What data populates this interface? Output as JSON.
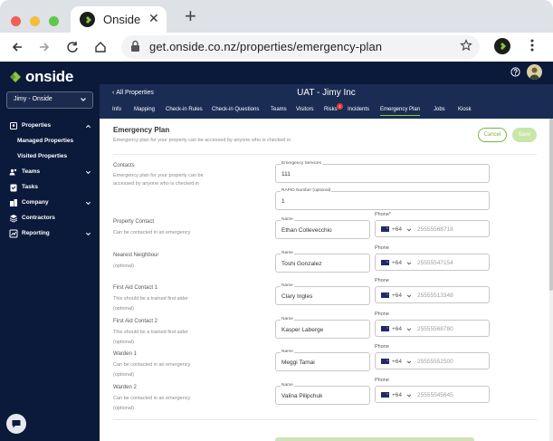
{
  "browser": {
    "tab_title": "Onside",
    "url": "get.onside.co.nz/properties/emergency-plan"
  },
  "sidebar": {
    "logo_text": "onside",
    "org_select": "Jimy - Onside",
    "items": [
      {
        "label": "Properties",
        "icon": "building-icon"
      },
      {
        "label": "Managed Properties"
      },
      {
        "label": "Visited Properties"
      },
      {
        "label": "Teams",
        "icon": "people-icon"
      },
      {
        "label": "Tasks",
        "icon": "clipboard-icon"
      },
      {
        "label": "Company",
        "icon": "company-icon"
      },
      {
        "label": "Contractors",
        "icon": "layers-icon"
      },
      {
        "label": "Reporting",
        "icon": "chart-icon"
      }
    ]
  },
  "header": {
    "back_label": "All Properties",
    "title": "UAT - Jimy Inc",
    "tabs": [
      "Info",
      "Mapping",
      "Check-in Rules",
      "Check-in Questions",
      "Teams",
      "Visitors",
      "Risks",
      "Incidents",
      "Emergency Plan",
      "Jobs",
      "Kiosk"
    ],
    "active_tab": "Emergency Plan",
    "risk_badge": "1"
  },
  "emergency_plan": {
    "title": "Emergency Plan",
    "description": "Emergency plan for your property can be accessed by anyone who is checked in",
    "cancel_label": "Cancel",
    "save_label": "Save",
    "contacts": {
      "label": "Contacts",
      "help": "Emergency plan for your property can be accessed by anyone who is checked in",
      "emergency_services_label": "Emergency Services",
      "emergency_services_value": "111",
      "rapid_label": "RAPID Number (optional)",
      "rapid_value": "1"
    },
    "name_label": "Name",
    "dial_code": "+64",
    "rows": [
      {
        "label": "Property Contact",
        "help": "Can be contacted in an emergency",
        "name": "Ethan Collevecchio",
        "phone_label": "Phone*",
        "phone": "25555568718"
      },
      {
        "label": "Nearest Neighbour",
        "help": "(optional)",
        "name": "Toshi Gonzalez",
        "phone_label": "Phone",
        "phone": "25555547154"
      },
      {
        "label": "First Aid Contact 1",
        "help": "This should be a trained first aider",
        "help2": "(optional)",
        "name": "Clary Ingles",
        "phone_label": "Phone",
        "phone": "25555513348"
      },
      {
        "label": "First Aid Contact 2",
        "help": "This should be a trained first aider",
        "help2": "(optional)",
        "name": "Kasper Laberge",
        "phone_label": "Phone",
        "phone": "25555568780"
      },
      {
        "label": "Warden 1",
        "help": "Can be contacted in an emergency",
        "help2": "(optional)",
        "name": "Meggi Tamai",
        "phone_label": "Phone",
        "phone": "25555552500"
      },
      {
        "label": "Warden 2",
        "help": "Can be contacted in an emergency",
        "help2": "(optional)",
        "name": "Valina Pilipchuk",
        "phone_label": "Phone",
        "phone": "25555545645"
      }
    ]
  }
}
